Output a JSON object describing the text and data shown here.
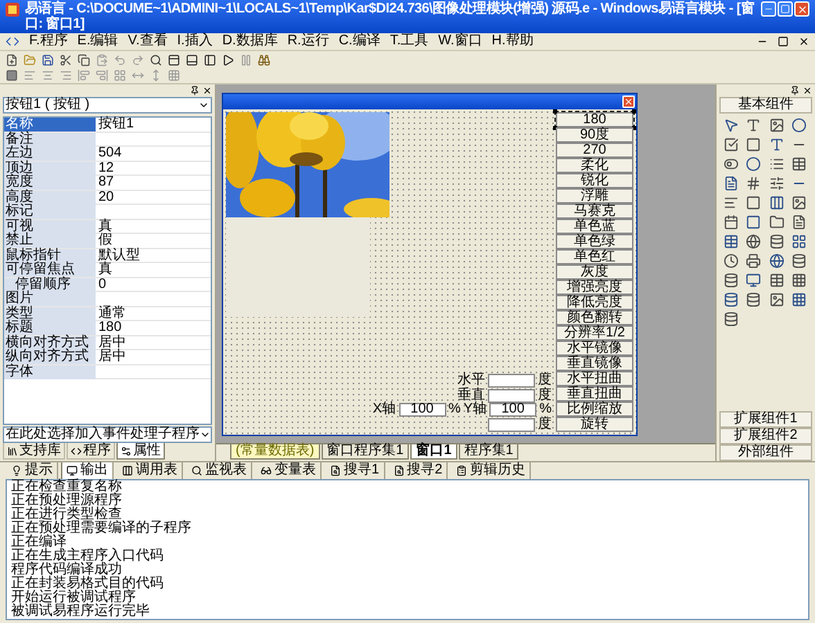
{
  "window": {
    "title": "易语言 - C:\\DOCUME~1\\ADMINI~1\\LOCALS~1\\Temp\\Kar$DI24.736\\图像处理模块(增强) 源码.e - Windows易语言模块 - [窗口: 窗口1]"
  },
  "menu": [
    "F.程序",
    "E.编辑",
    "V.查看",
    "I.插入",
    "D.数据库",
    "R.运行",
    "C.编译",
    "T.工具",
    "W.窗口",
    "H.帮助"
  ],
  "properties_panel": {
    "object_selector": "按钮1 ( 按钮 )",
    "rows": [
      {
        "name": "名称",
        "value": "按钮1",
        "selected": true,
        "indented": false
      },
      {
        "name": "备注",
        "selected": false,
        "indented": false
      },
      {
        "name": "左边",
        "value": "504",
        "selected": false,
        "indented": false
      },
      {
        "name": "顶边",
        "value": "12",
        "selected": false,
        "indented": false
      },
      {
        "name": "宽度",
        "value": "87",
        "selected": false,
        "indented": false
      },
      {
        "name": "高度",
        "value": "20",
        "selected": false,
        "indented": false
      },
      {
        "name": "标记",
        "selected": false,
        "indented": false
      },
      {
        "name": "可视",
        "value": "真",
        "selected": false,
        "indented": false
      },
      {
        "name": "禁止",
        "value": "假",
        "selected": false,
        "indented": false
      },
      {
        "name": "鼠标指针",
        "value": "默认型",
        "selected": false,
        "indented": false
      },
      {
        "name": "可停留焦点",
        "value": "真",
        "selected": false,
        "indented": false
      },
      {
        "name": "停留顺序",
        "value": "0",
        "selected": false,
        "indented": true
      },
      {
        "name": "图片",
        "selected": false,
        "indented": false
      },
      {
        "name": "类型",
        "value": "通常",
        "selected": false,
        "indented": false
      },
      {
        "name": "标题",
        "value": "180",
        "selected": false,
        "indented": false
      },
      {
        "name": "横向对齐方式",
        "value": "居中",
        "selected": false,
        "indented": false
      },
      {
        "name": "纵向对齐方式",
        "value": "居中",
        "selected": false,
        "indented": false
      },
      {
        "name": "字体",
        "selected": false,
        "indented": false
      }
    ],
    "event_selector": "在此处选择加入事件处理子程序",
    "tabs": [
      {
        "label": "支持库",
        "selected": false
      },
      {
        "label": "程序",
        "selected": false
      },
      {
        "label": "属性",
        "selected": true
      }
    ]
  },
  "form": {
    "buttons": [
      {
        "label": "180",
        "selected": true
      },
      {
        "label": "90度",
        "selected": false
      },
      {
        "label": "270",
        "selected": false
      },
      {
        "label": "柔化",
        "selected": false
      },
      {
        "label": "锐化",
        "selected": false
      },
      {
        "label": "浮雕",
        "selected": false
      },
      {
        "label": "马赛克",
        "selected": false
      },
      {
        "label": "单色蓝",
        "selected": false
      },
      {
        "label": "单色绿",
        "selected": false
      },
      {
        "label": "单色红",
        "selected": false
      },
      {
        "label": "灰度",
        "selected": false
      },
      {
        "label": "增强亮度",
        "selected": false
      },
      {
        "label": "降低亮度",
        "selected": false
      },
      {
        "label": "颜色翻转",
        "selected": false
      },
      {
        "label": "分辨率1/2",
        "selected": false
      },
      {
        "label": "水平镜像",
        "selected": false
      },
      {
        "label": "垂直镜像",
        "selected": false
      },
      {
        "label": "水平扭曲",
        "selected": false
      },
      {
        "label": "垂直扭曲",
        "selected": false
      },
      {
        "label": "比例缩放",
        "selected": false
      },
      {
        "label": "旋转",
        "selected": false
      }
    ],
    "field_rows": [
      [
        {
          "kind": "label",
          "text": "水平"
        },
        {
          "kind": "field"
        },
        {
          "kind": "label",
          "text": "度"
        }
      ],
      [
        {
          "kind": "label",
          "text": "垂直"
        },
        {
          "kind": "field"
        },
        {
          "kind": "label",
          "text": "度"
        }
      ],
      [
        {
          "kind": "label",
          "text": "X轴"
        },
        {
          "kind": "field",
          "value": "100"
        },
        {
          "kind": "label",
          "text": "%"
        },
        {
          "kind": "label",
          "text": "Y轴"
        },
        {
          "kind": "field",
          "value": "100"
        },
        {
          "kind": "label",
          "text": "%"
        }
      ],
      [
        {
          "kind": "field"
        },
        {
          "kind": "label",
          "text": "度"
        }
      ]
    ]
  },
  "document_tabs": [
    {
      "label": "(常量数据表)",
      "kind": "resource",
      "selected": false
    },
    {
      "label": "窗口程序集1",
      "kind": "code",
      "selected": false
    },
    {
      "label": "窗口1",
      "kind": "code",
      "selected": true
    },
    {
      "label": "程序集1",
      "kind": "code",
      "selected": false
    }
  ],
  "component_palette": {
    "header": "基本组件",
    "footer": [
      "扩展组件1",
      "扩展组件2",
      "外部组件"
    ]
  },
  "output_tabs": [
    {
      "label": "提示",
      "selected": false
    },
    {
      "label": "输出",
      "selected": true
    },
    {
      "label": "调用表",
      "selected": false
    },
    {
      "label": "监视表",
      "selected": false
    },
    {
      "label": "变量表",
      "selected": false
    },
    {
      "label": "搜寻1",
      "selected": false
    },
    {
      "label": "搜寻2",
      "selected": false
    },
    {
      "label": "剪辑历史",
      "selected": false
    }
  ],
  "output_log": [
    "正在检查重复名称",
    "正在预处理源程序",
    "正在进行类型检查",
    "正在预处理需要编译的子程序",
    "正在编译",
    "正在生成主程序入口代码",
    "程序代码编译成功",
    "正在封装易格式目的代码",
    "开始运行被调试程序",
    "被调试易程序运行完毕"
  ]
}
